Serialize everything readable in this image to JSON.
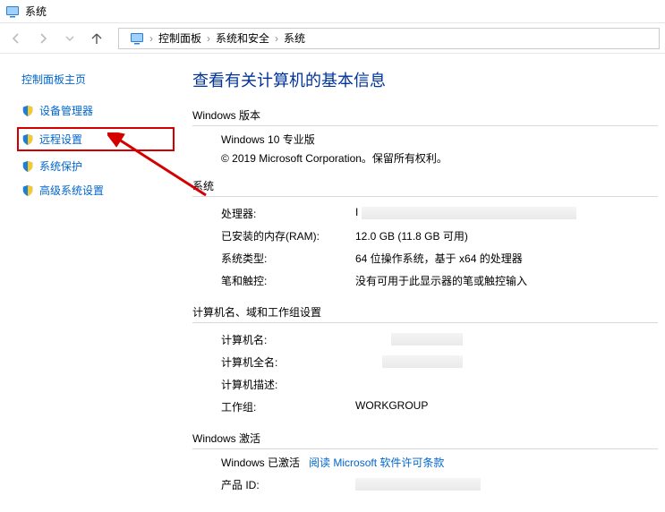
{
  "title": "系统",
  "breadcrumb": {
    "a": "控制面板",
    "b": "系统和安全",
    "c": "系统"
  },
  "sidebar": {
    "home": "控制面板主页",
    "items": [
      {
        "label": "设备管理器"
      },
      {
        "label": "远程设置"
      },
      {
        "label": "系统保护"
      },
      {
        "label": "高级系统设置"
      }
    ]
  },
  "main": {
    "page_title": "查看有关计算机的基本信息",
    "edition_section": "Windows 版本",
    "edition_name": "Windows 10 专业版",
    "copyright": "© 2019 Microsoft Corporation。保留所有权利。",
    "system_section": "系统",
    "rows": {
      "processor_k": "处理器:",
      "processor_v": "I",
      "ram_k": "已安装的内存(RAM):",
      "ram_v": "12.0 GB (11.8 GB 可用)",
      "type_k": "系统类型:",
      "type_v": "64 位操作系统，基于 x64 的处理器",
      "pen_k": "笔和触控:",
      "pen_v": "没有可用于此显示器的笔或触控输入"
    },
    "name_section": "计算机名、域和工作组设置",
    "name_rows": {
      "name_k": "计算机名:",
      "full_k": "计算机全名:",
      "desc_k": "计算机描述:",
      "workgroup_k": "工作组:",
      "workgroup_v": "WORKGROUP"
    },
    "activation_section": "Windows 激活",
    "activation_status": "Windows 已激活",
    "activation_link": "阅读 Microsoft 软件许可条款",
    "product_id_k": "产品 ID:"
  }
}
